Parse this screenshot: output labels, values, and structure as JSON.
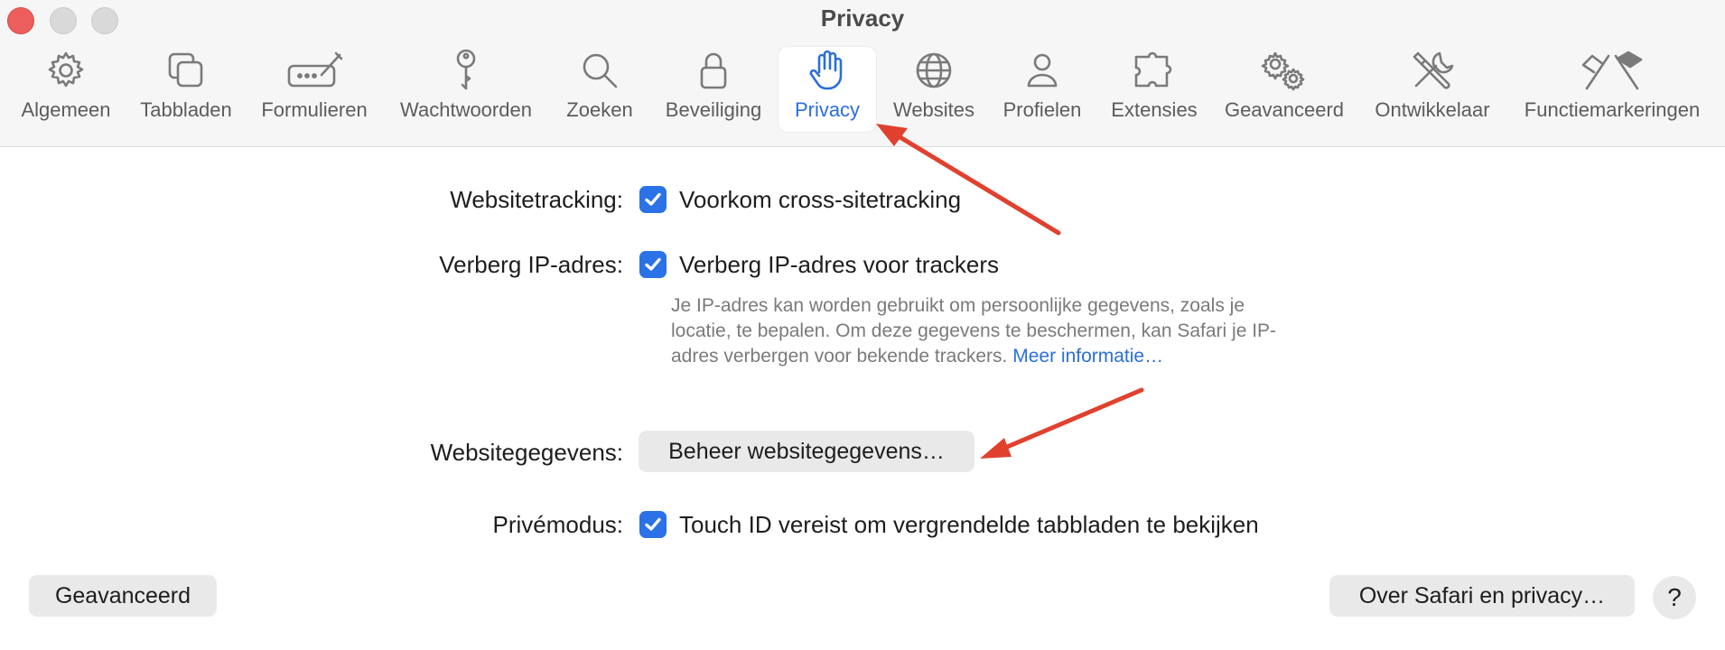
{
  "window": {
    "title": "Privacy"
  },
  "toolbar": {
    "items": [
      {
        "label": "Algemeen",
        "icon": "gear-icon"
      },
      {
        "label": "Tabbladen",
        "icon": "tabs-icon"
      },
      {
        "label": "Formulieren",
        "icon": "autofill-icon"
      },
      {
        "label": "Wachtwoorden",
        "icon": "key-icon"
      },
      {
        "label": "Zoeken",
        "icon": "search-icon"
      },
      {
        "label": "Beveiliging",
        "icon": "lock-icon"
      },
      {
        "label": "Privacy",
        "icon": "hand-icon"
      },
      {
        "label": "Websites",
        "icon": "globe-icon"
      },
      {
        "label": "Profielen",
        "icon": "person-icon"
      },
      {
        "label": "Extensies",
        "icon": "puzzle-icon"
      },
      {
        "label": "Geavanceerd",
        "icon": "gears-icon"
      },
      {
        "label": "Ontwikkelaar",
        "icon": "tools-icon"
      },
      {
        "label": "Functiemarkeringen",
        "icon": "flags-icon"
      }
    ],
    "selected": "Privacy"
  },
  "settings": {
    "tracking_label": "Websitetracking:",
    "tracking_option": "Voorkom cross-sitetracking",
    "hide_ip_label": "Verberg IP-adres:",
    "hide_ip_option": "Verberg IP-adres voor trackers",
    "hide_ip_help": "Je IP-adres kan worden gebruikt om persoonlijke gegevens, zoals je locatie, te bepalen. Om deze gegevens te beschermen, kan Safari je IP-adres verbergen voor bekende trackers.",
    "hide_ip_link": "Meer informatie…",
    "website_data_label": "Websitegegevens:",
    "website_data_button": "Beheer websitegegevens…",
    "private_label": "Privémodus:",
    "private_option": "Touch ID vereist om vergrendelde tabbladen te bekijken"
  },
  "footer": {
    "advanced_button": "Geavanceerd",
    "about_button": "Over Safari en privacy…",
    "help_button": "?"
  },
  "colors": {
    "accent": "#2a6fdb",
    "checkbox": "#2a72e6",
    "annotation_arrow": "#e0412f"
  }
}
